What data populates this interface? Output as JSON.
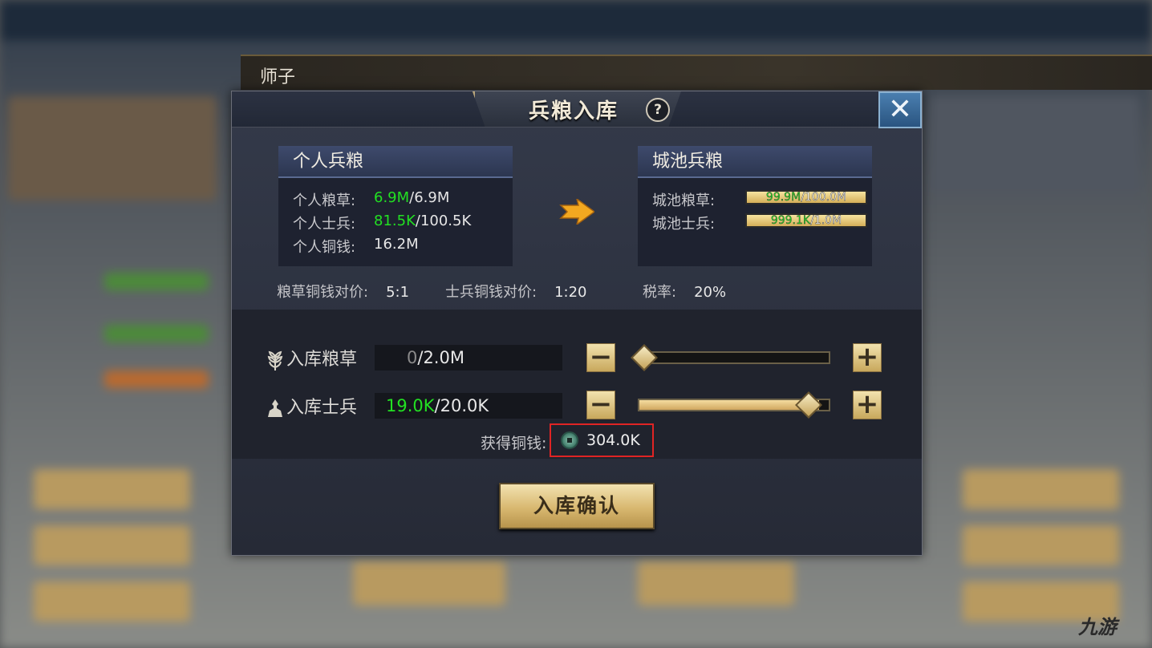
{
  "header": {
    "player_name": "师子"
  },
  "dialog": {
    "title": "兵粮入库",
    "help_icon": "?",
    "close_icon": "✕",
    "personal": {
      "title": "个人兵粮",
      "grain_label": "个人粮草:",
      "grain_current": "6.9M",
      "grain_max": "/6.9M",
      "soldiers_label": "个人士兵:",
      "soldiers_current": "81.5K",
      "soldiers_max": "/100.5K",
      "copper_label": "个人铜钱:",
      "copper_value": "16.2M"
    },
    "city": {
      "title": "城池兵粮",
      "grain_label": "城池粮草:",
      "grain_current": "99.9M",
      "grain_max": "/100.0M",
      "grain_fill": 0.999,
      "soldiers_label": "城池士兵:",
      "soldiers_current": "999.1K",
      "soldiers_max": "/1.0M",
      "soldiers_fill": 0.999
    },
    "rates": {
      "grain_rate_label": "粮草铜钱对价:",
      "grain_rate_value": "5:1",
      "soldier_rate_label": "士兵铜钱对价:",
      "soldier_rate_value": "1:20",
      "tax_label": "税率:",
      "tax_value": "20%"
    },
    "deposit_grain": {
      "label": "入库粮草",
      "current": "0",
      "max": "/2.0M",
      "slider_level": 0.0
    },
    "deposit_soldiers": {
      "label": "入库士兵",
      "current": "19.0K",
      "max": "/20.0K",
      "slider_level": 0.95
    },
    "earn": {
      "label": "获得铜钱:",
      "value": "304.0K"
    },
    "confirm_label": "入库确认",
    "minus_symbol": "−",
    "plus_symbol": "+"
  },
  "watermark": "九游",
  "colors": {
    "accent_gold": "#d8b870",
    "value_green": "#22e022",
    "highlight_red": "#e02424"
  }
}
